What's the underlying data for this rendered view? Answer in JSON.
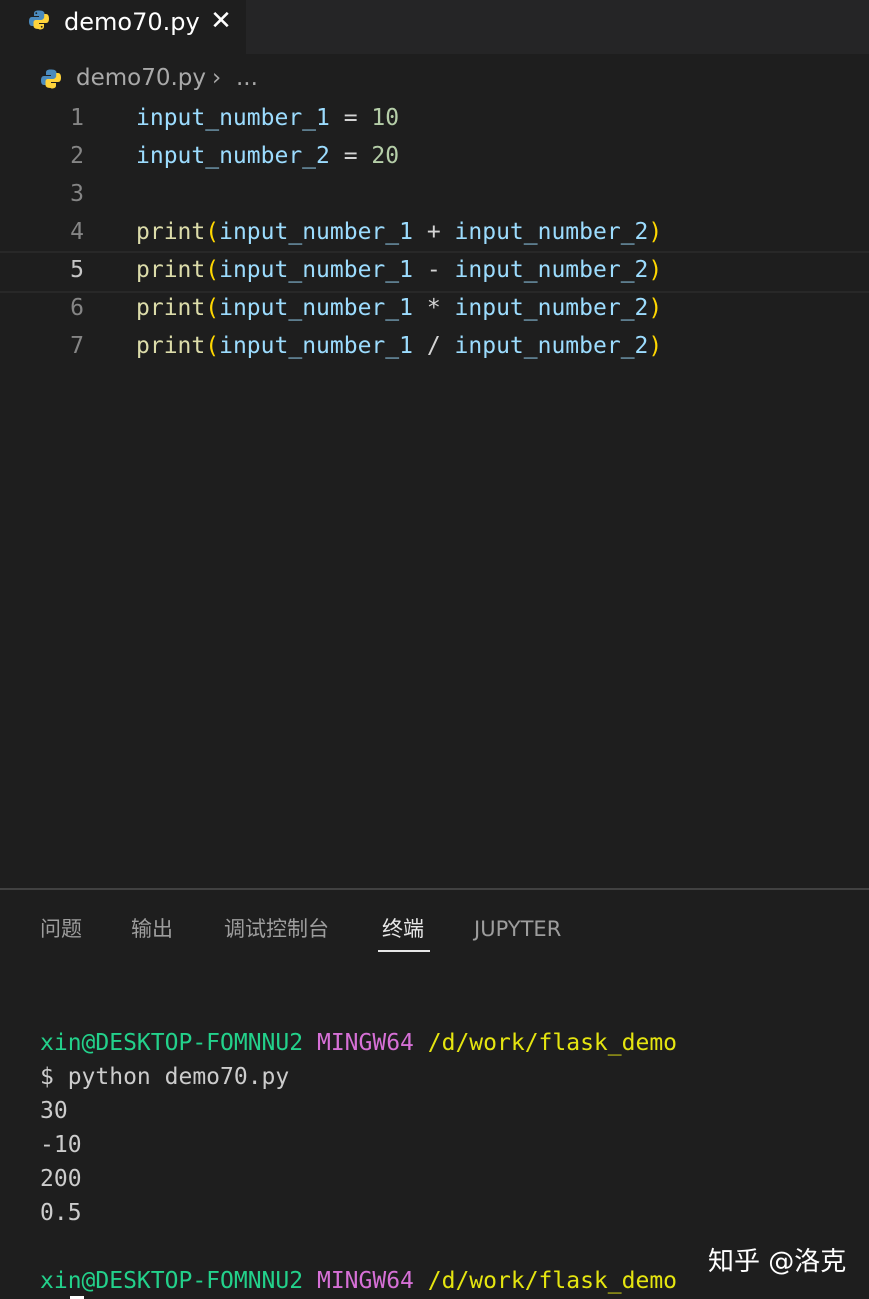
{
  "tab": {
    "icon": "python-icon",
    "filename": "demo70.py",
    "close_glyph": "✕"
  },
  "breadcrumb": {
    "icon": "python-icon",
    "file": "demo70.py",
    "separator": "›",
    "more": "..."
  },
  "editor": {
    "lines": [
      {
        "num": "1",
        "tokens": [
          [
            "var",
            "input_number_1"
          ],
          [
            "op",
            " = "
          ],
          [
            "num",
            "10"
          ]
        ]
      },
      {
        "num": "2",
        "tokens": [
          [
            "var",
            "input_number_2"
          ],
          [
            "op",
            " = "
          ],
          [
            "num",
            "20"
          ]
        ]
      },
      {
        "num": "3",
        "tokens": []
      },
      {
        "num": "4",
        "tokens": [
          [
            "fn",
            "print"
          ],
          [
            "paren",
            "("
          ],
          [
            "var",
            "input_number_1"
          ],
          [
            "op",
            " + "
          ],
          [
            "var",
            "input_number_2"
          ],
          [
            "paren",
            ")"
          ]
        ]
      },
      {
        "num": "5",
        "tokens": [
          [
            "fn",
            "print"
          ],
          [
            "paren",
            "("
          ],
          [
            "var",
            "input_number_1"
          ],
          [
            "op",
            " - "
          ],
          [
            "var",
            "input_number_2"
          ],
          [
            "paren",
            ")"
          ]
        ]
      },
      {
        "num": "6",
        "tokens": [
          [
            "fn",
            "print"
          ],
          [
            "paren",
            "("
          ],
          [
            "var",
            "input_number_1"
          ],
          [
            "op",
            " * "
          ],
          [
            "var",
            "input_number_2"
          ],
          [
            "paren",
            ")"
          ]
        ]
      },
      {
        "num": "7",
        "tokens": [
          [
            "fn",
            "print"
          ],
          [
            "paren",
            "("
          ],
          [
            "var",
            "input_number_1"
          ],
          [
            "op",
            " / "
          ],
          [
            "var",
            "input_number_2"
          ],
          [
            "paren",
            ")"
          ]
        ]
      }
    ],
    "current_line": "5"
  },
  "panel": {
    "tabs": {
      "problems": "问题",
      "output": "输出",
      "debug_console": "调试控制台",
      "terminal": "终端",
      "jupyter": "JUPYTER"
    },
    "active_tab": "terminal"
  },
  "terminal": {
    "prompt1": {
      "user": "xin@DESKTOP-FOMNNU2",
      "host": "MINGW64",
      "path": "/d/work/flask_demo"
    },
    "command": "$ python demo70.py",
    "outputs": [
      "30",
      "-10",
      "200",
      "0.5"
    ],
    "prompt2": {
      "user": "xin@DESKTOP-FOMNNU2",
      "host": "MINGW64",
      "path": "/d/work/flask_demo"
    }
  },
  "watermark": "知乎 @洛克",
  "colors": {
    "variable": "#9cdcfe",
    "number": "#b5cea8",
    "function": "#dcdcaa",
    "paren": "#ffd700",
    "terminal_user": "#23d18b",
    "terminal_host": "#d670d6",
    "terminal_path": "#e5e510"
  }
}
